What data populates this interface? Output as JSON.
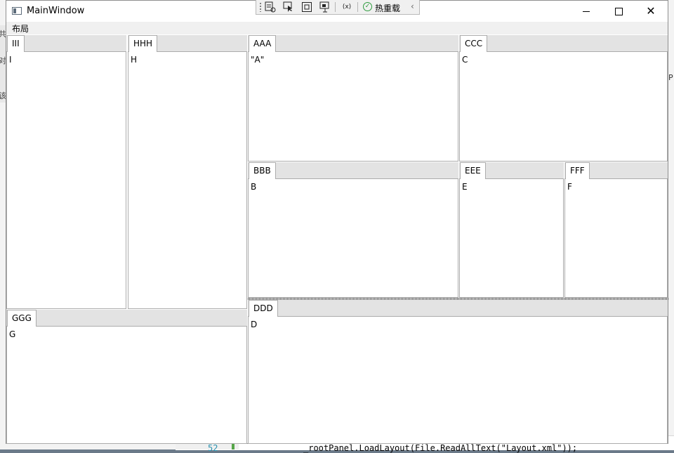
{
  "background": {
    "line_number": "52",
    "code_text": "_rootPanel.LoadLayout(File.ReadAllText(\"Layout.xml\"));",
    "left_glyphs": [
      "共",
      "对",
      "该"
    ],
    "right_glyph": "P"
  },
  "window": {
    "title": "MainWindow",
    "minimize_label": "Minimize",
    "maximize_label": "Maximize",
    "close_label": "Close"
  },
  "debug_toolbar": {
    "hot_reload_label": "热重载",
    "icons": [
      "live-visual-tree-icon",
      "select-element-icon",
      "display-layout-adorners-icon",
      "track-focus-icon",
      "binding-failures-icon",
      "hot-reload-check-icon",
      "collapse-chevron-icon"
    ]
  },
  "menu": {
    "items": [
      "布局"
    ]
  },
  "panes": {
    "iii": {
      "tab": "III",
      "content": "I"
    },
    "hhh": {
      "tab": "HHH",
      "content": "H"
    },
    "ggg": {
      "tab": "GGG",
      "content": "G"
    },
    "aaa": {
      "tab": "AAA",
      "content": "\"A\""
    },
    "ccc": {
      "tab": "CCC",
      "content": "C"
    },
    "bbb": {
      "tab": "BBB",
      "content": "B"
    },
    "eee": {
      "tab": "EEE",
      "content": "E"
    },
    "fff": {
      "tab": "FFF",
      "content": "F"
    },
    "ddd": {
      "tab": "DDD",
      "content": "D"
    }
  }
}
